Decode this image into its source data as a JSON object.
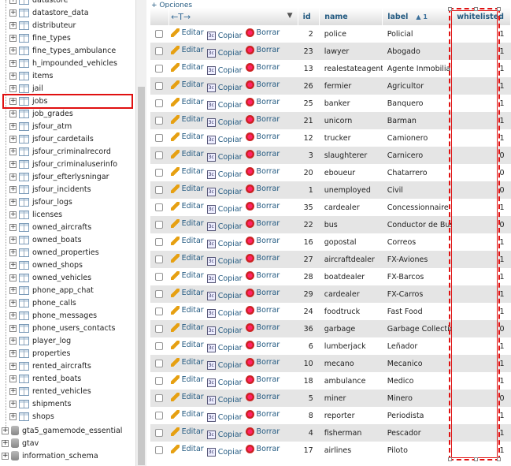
{
  "nav": {
    "partial_top_label": "datastore",
    "tables": [
      "datastore_data",
      "distributeur",
      "fine_types",
      "fine_types_ambulance",
      "h_impounded_vehicles",
      "items",
      "jail",
      "jobs",
      "job_grades",
      "jsfour_atm",
      "jsfour_cardetails",
      "jsfour_criminalrecord",
      "jsfour_criminaluserinfo",
      "jsfour_efterlysningar",
      "jsfour_incidents",
      "jsfour_logs",
      "licenses",
      "owned_aircrafts",
      "owned_boats",
      "owned_properties",
      "owned_shops",
      "owned_vehicles",
      "phone_app_chat",
      "phone_calls",
      "phone_messages",
      "phone_users_contacts",
      "player_log",
      "properties",
      "rented_aircrafts",
      "rented_boats",
      "rented_vehicles",
      "shipments",
      "shops"
    ],
    "selected_table": "jobs",
    "databases": [
      "gta5_gamemode_essential",
      "gtav",
      "information_schema"
    ]
  },
  "toolbar": {
    "options_label": "+ Opciones",
    "nav_arrows": "←T→",
    "filter_icon": "▼"
  },
  "columns": {
    "id": "id",
    "name": "name",
    "label": "label",
    "label_sort": "▲ 1",
    "whitelisted": "whitelisted"
  },
  "actions": {
    "edit": "Editar",
    "copy": "Copiar",
    "delete": "Borrar"
  },
  "rows": [
    {
      "id": "2",
      "name": "police",
      "label": "Policial",
      "whitelisted": "1"
    },
    {
      "id": "23",
      "name": "lawyer",
      "label": "Abogado",
      "whitelisted": "1"
    },
    {
      "id": "13",
      "name": "realestateagent",
      "label": "Agente Inmobiliario",
      "whitelisted": "1"
    },
    {
      "id": "26",
      "name": "fermier",
      "label": "Agricultor",
      "whitelisted": "1"
    },
    {
      "id": "25",
      "name": "banker",
      "label": "Banquero",
      "whitelisted": "1"
    },
    {
      "id": "21",
      "name": "unicorn",
      "label": "Barman",
      "whitelisted": "1"
    },
    {
      "id": "12",
      "name": "trucker",
      "label": "Camionero",
      "whitelisted": "1"
    },
    {
      "id": "3",
      "name": "slaughterer",
      "label": "Carnicero",
      "whitelisted": "0"
    },
    {
      "id": "20",
      "name": "eboueur",
      "label": "Chatarrero",
      "whitelisted": "0"
    },
    {
      "id": "1",
      "name": "unemployed",
      "label": "Civil",
      "whitelisted": "0"
    },
    {
      "id": "35",
      "name": "cardealer",
      "label": "Concessionnaire",
      "whitelisted": "1"
    },
    {
      "id": "22",
      "name": "bus",
      "label": "Conductor de Bus",
      "whitelisted": "0"
    },
    {
      "id": "16",
      "name": "gopostal",
      "label": "Correos",
      "whitelisted": "1"
    },
    {
      "id": "27",
      "name": "aircraftdealer",
      "label": "FX-Aviones",
      "whitelisted": "1"
    },
    {
      "id": "28",
      "name": "boatdealer",
      "label": "FX-Barcos",
      "whitelisted": "1"
    },
    {
      "id": "29",
      "name": "cardealer",
      "label": "FX-Carros",
      "whitelisted": "1"
    },
    {
      "id": "24",
      "name": "foodtruck",
      "label": "Fast Food",
      "whitelisted": "1"
    },
    {
      "id": "36",
      "name": "garbage",
      "label": "Garbage Collection",
      "whitelisted": "0"
    },
    {
      "id": "6",
      "name": "lumberjack",
      "label": "Leñador",
      "whitelisted": "1"
    },
    {
      "id": "10",
      "name": "mecano",
      "label": "Mecanico",
      "whitelisted": "1"
    },
    {
      "id": "18",
      "name": "ambulance",
      "label": "Medico",
      "whitelisted": "1"
    },
    {
      "id": "5",
      "name": "miner",
      "label": "Minero",
      "whitelisted": "0"
    },
    {
      "id": "8",
      "name": "reporter",
      "label": "Periodista",
      "whitelisted": "1"
    },
    {
      "id": "4",
      "name": "fisherman",
      "label": "Pescador",
      "whitelisted": "1"
    },
    {
      "id": "17",
      "name": "airlines",
      "label": "Piloto",
      "whitelisted": "1"
    }
  ]
}
